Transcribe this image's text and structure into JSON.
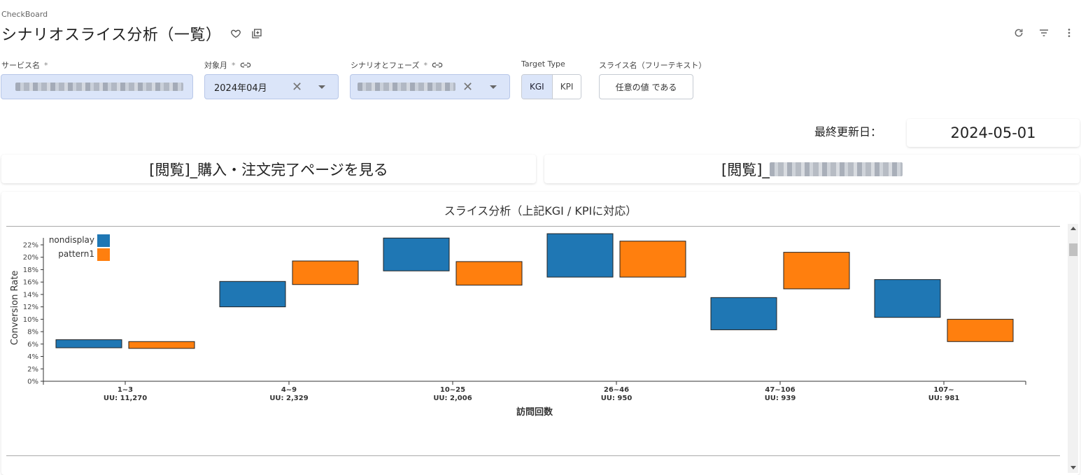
{
  "app": {
    "breadcrumb": "CheckBoard",
    "title": "シナリオスライス分析（一覧）"
  },
  "filters": {
    "service": {
      "label": "サービス名",
      "required": "*"
    },
    "month": {
      "label": "対象月",
      "required": "*",
      "value": "2024年04月"
    },
    "scenario": {
      "label": "シナリオとフェーズ",
      "required": "*"
    },
    "target_type": {
      "label": "Target Type",
      "options": [
        "KGI",
        "KPI"
      ],
      "selected": "KGI"
    },
    "slice_name": {
      "label": "スライス名（フリーテキスト）",
      "button": "任意の値 である"
    }
  },
  "updated": {
    "label": "最終更新日：",
    "value": "2024-05-01"
  },
  "metrics": {
    "left": "[閲覧]_購入・注文完了ページを見る",
    "right_prefix": "[閲覧]_"
  },
  "chart_title": "スライス分析（上記KGI / KPIに対応）",
  "chart_data": {
    "type": "bar",
    "subtype": "floating range bars",
    "categories": [
      "1~3",
      "4~9",
      "10~25",
      "26~46",
      "47~106",
      "107~"
    ],
    "uu_labels": [
      "UU: 11,270",
      "UU: 2,329",
      "UU: 2,006",
      "UU: 950",
      "UU: 939",
      "UU: 981"
    ],
    "series": [
      {
        "name": "nondisplay",
        "color": "#1f77b4",
        "low": [
          5.4,
          12.0,
          17.8,
          16.8,
          8.3,
          10.3
        ],
        "high": [
          6.7,
          16.1,
          23.1,
          23.8,
          13.5,
          16.4
        ]
      },
      {
        "name": "pattern1",
        "color": "#ff7f0e",
        "low": [
          5.3,
          15.6,
          15.5,
          16.8,
          14.9,
          6.4
        ],
        "high": [
          6.4,
          19.4,
          19.3,
          22.6,
          20.8,
          10.0
        ]
      }
    ],
    "xlabel": "訪問回数",
    "ylabel": "Conversion Rate",
    "ylim": [
      0,
      22
    ],
    "yticks": [
      "0%",
      "2%",
      "4%",
      "6%",
      "8%",
      "10%",
      "12%",
      "14%",
      "16%",
      "18%",
      "20%",
      "22%"
    ],
    "legend_position": "top-left"
  }
}
